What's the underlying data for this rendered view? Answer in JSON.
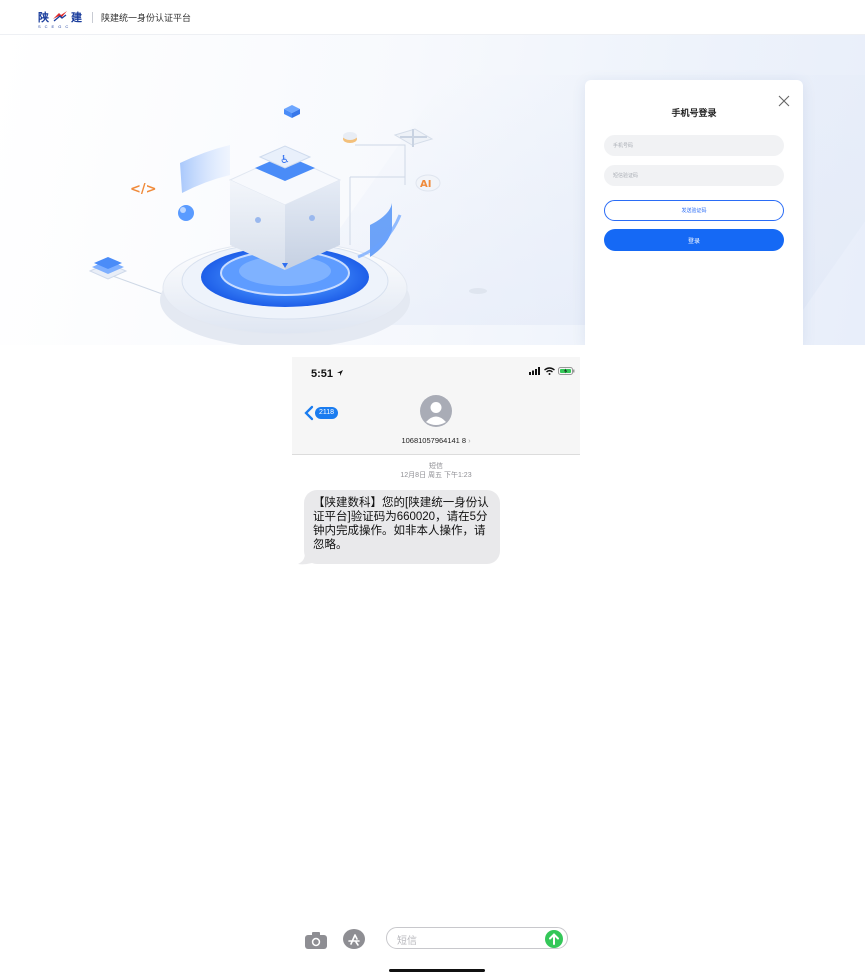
{
  "header": {
    "logo_text": "陕建",
    "logo_sub": "SCEGC",
    "platform_title": "陕建统一身份认证平台"
  },
  "hero": {
    "illustration_labels": {
      "code_tag": "</>",
      "ai_tag": "AI"
    },
    "colors": {
      "accent": "#1569f5",
      "illustration_blue": "#2f7bf5"
    }
  },
  "login": {
    "title": "手机号登录",
    "phone_placeholder": "手机号码",
    "code_placeholder": "短信验证码",
    "send_code_label": "发送验证码",
    "login_label": "登录",
    "close_icon": "close-icon"
  },
  "phone": {
    "status_bar": {
      "time": "5:51",
      "signal": "signal-icon",
      "wifi": "wifi-icon",
      "battery": "battery-charging-icon"
    },
    "back_badge": "2118",
    "contact_number": "10681057964141 8",
    "meta_type": "短信",
    "meta_time": "12月8日 周五 下午1:23",
    "message": "【陕建数科】您的[陕建统一身份认证平台]验证码为660020，请在5分钟内完成操作。如非本人操作，请忽略。",
    "input_placeholder": "短信"
  }
}
